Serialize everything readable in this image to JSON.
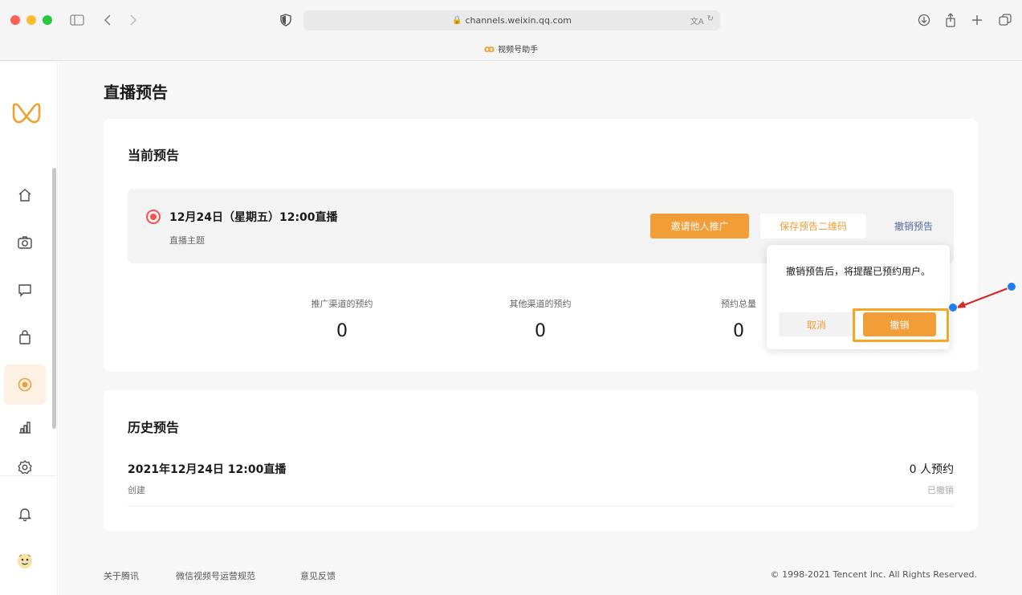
{
  "browser": {
    "url": "channels.weixin.qq.com",
    "tab_title": "视频号助手",
    "traffic_colors": [
      "#fe5f57",
      "#febc2e",
      "#28c840"
    ]
  },
  "sidebar": {
    "items": [
      {
        "icon": "home-icon"
      },
      {
        "icon": "camera-icon"
      },
      {
        "icon": "comment-icon"
      },
      {
        "icon": "shopping-bag-icon"
      },
      {
        "icon": "live-icon",
        "active": true
      },
      {
        "icon": "chart-icon"
      },
      {
        "icon": "settings-icon"
      },
      {
        "icon": "bell-icon"
      },
      {
        "icon": "avatar"
      }
    ]
  },
  "page": {
    "title": "直播预告"
  },
  "current": {
    "title": "当前预告",
    "date": "12月24日（星期五）12:00直播",
    "topic": "直播主题",
    "invite_label": "邀请他人推广",
    "save_label": "保存预告二维码",
    "cancel_label": "撤销预告",
    "stats": [
      {
        "label": "推广渠道的预约",
        "value": "0"
      },
      {
        "label": "其他渠道的预约",
        "value": "0"
      },
      {
        "label": "预约总量",
        "value": "0"
      }
    ]
  },
  "popover": {
    "message": "撤销预告后，将提醒已预约用户。",
    "cancel_label": "取消",
    "confirm_label": "撤销"
  },
  "history": {
    "title": "历史预告",
    "items": [
      {
        "date": "2021年12月24日 12:00直播",
        "created": "创建",
        "count": "0 人预约",
        "status": "已撤销"
      }
    ]
  },
  "footer": {
    "links": [
      "关于腾讯",
      "微信视频号运营规范",
      "意见反馈"
    ],
    "copyright": "© 1998-2021 Tencent Inc. All Rights Reserved."
  },
  "colors": {
    "accent": "#f19d38",
    "live_red": "#fa5151",
    "link": "#576b95",
    "highlight": "#f5a623",
    "annotation_arrow": "#d42a2a",
    "annotation_dot": "#1e7cf5"
  }
}
